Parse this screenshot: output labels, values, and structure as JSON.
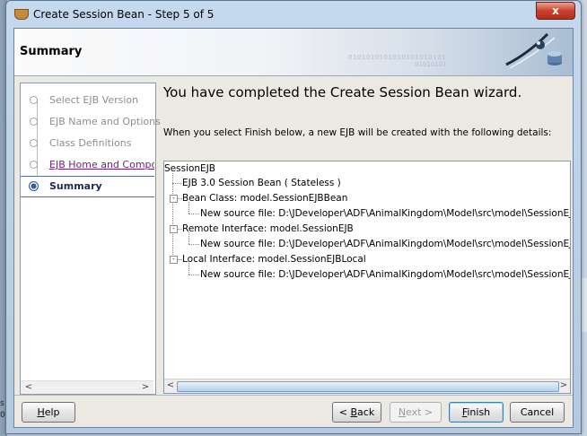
{
  "window": {
    "title": "Create Session Bean - Step 5 of 5",
    "close_glyph": "x"
  },
  "header": {
    "title": "Summary",
    "binary_text_1": "0101010101010101010101",
    "binary_text_2": "01010101"
  },
  "train": {
    "steps": [
      {
        "label": "Select EJB Version",
        "state": "visited"
      },
      {
        "label": "EJB Name and Options",
        "state": "visited"
      },
      {
        "label": "Class Definitions",
        "state": "visited"
      },
      {
        "label": "EJB Home and Component Interfaces",
        "state": "link"
      },
      {
        "label": "Summary",
        "state": "current"
      }
    ]
  },
  "content": {
    "heading": "You have completed the Create Session Bean wizard.",
    "description": "When you select Finish below, a new EJB will be created with the following details:"
  },
  "tree": {
    "root": "SessionEJB",
    "session_bean": "EJB 3.0 Session Bean ( Stateless )",
    "bean_class": "Bean Class: model.SessionEJBBean",
    "bean_class_file": "New source file: D:\\JDeveloper\\ADF\\AnimalKingdom\\Model\\src\\model\\SessionEJBBean",
    "remote_interface": "Remote Interface: model.SessionEJB",
    "remote_interface_file": "New source file: D:\\JDeveloper\\ADF\\AnimalKingdom\\Model\\src\\model\\SessionEJB.java",
    "local_interface": "Local Interface: model.SessionEJBLocal",
    "local_interface_file": "New source file: D:\\JDeveloper\\ADF\\AnimalKingdom\\Model\\src\\model\\SessionEJBLocal",
    "collapse_glyph": "-"
  },
  "buttons": {
    "help": {
      "mnemonic": "H",
      "rest": "elp"
    },
    "back": {
      "prefix": "< ",
      "mnemonic": "B",
      "rest": "ack"
    },
    "next": {
      "mnemonic": "N",
      "rest": "ext >"
    },
    "finish": {
      "mnemonic": "F",
      "rest": "inish"
    },
    "cancel": "Cancel"
  },
  "scroll": {
    "left": "<",
    "right": ">"
  },
  "desktop": {
    "fragment_1": "s",
    "fragment_2": "0."
  }
}
